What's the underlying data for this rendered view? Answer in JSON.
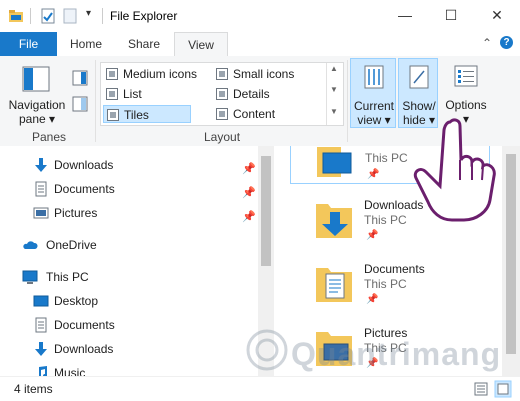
{
  "window": {
    "title": "File Explorer",
    "minimize": "—",
    "maximize": "☐",
    "close": "✕"
  },
  "tabs": [
    {
      "label": "File"
    },
    {
      "label": "Home"
    },
    {
      "label": "Share"
    },
    {
      "label": "View"
    }
  ],
  "ribbon": {
    "panes": {
      "navigation_pane_line1": "Navigation",
      "navigation_pane_line2": "pane ▾",
      "group_label": "Panes"
    },
    "layout": {
      "items": [
        {
          "label": "Medium icons"
        },
        {
          "label": "Small icons"
        },
        {
          "label": "List"
        },
        {
          "label": "Details"
        },
        {
          "label": "Tiles"
        },
        {
          "label": "Content"
        }
      ],
      "group_label": "Layout"
    },
    "current_view": {
      "line1": "Current",
      "line2": "view ▾"
    },
    "show_hide": {
      "line1": "Show/",
      "line2": "hide ▾"
    },
    "options": {
      "line1": "Options",
      "line2": "▾"
    },
    "help_icon": "?",
    "collapse_icon": "⌃"
  },
  "nav_pane": {
    "items": [
      {
        "label": "Downloads",
        "icon": "download-arrow-icon",
        "pinned": true
      },
      {
        "label": "Documents",
        "icon": "document-icon",
        "pinned": true
      },
      {
        "label": "Pictures",
        "icon": "picture-icon",
        "pinned": true
      },
      {
        "label": "OneDrive",
        "icon": "cloud-icon",
        "pinned": false
      },
      {
        "label": "This PC",
        "icon": "monitor-icon",
        "pinned": false
      },
      {
        "label": "Desktop",
        "icon": "desktop-icon",
        "pinned": false
      },
      {
        "label": "Documents",
        "icon": "document-icon",
        "pinned": false
      },
      {
        "label": "Downloads",
        "icon": "download-arrow-icon",
        "pinned": false
      },
      {
        "label": "Music",
        "icon": "music-icon",
        "pinned": false
      }
    ],
    "pin_glyph": "📌"
  },
  "content": {
    "tiles": [
      {
        "name": "",
        "sub": "This PC",
        "icon": "desktop-folder-icon"
      },
      {
        "name": "Downloads",
        "sub": "This PC",
        "icon": "downloads-folder-icon"
      },
      {
        "name": "Documents",
        "sub": "This PC",
        "icon": "documents-folder-icon"
      },
      {
        "name": "Pictures",
        "sub": "This PC",
        "icon": "pictures-folder-icon"
      }
    ]
  },
  "status": {
    "items_count": "4 items"
  },
  "watermark": {
    "text": "Quantrimang"
  },
  "colors": {
    "file_tab": "#1979ca",
    "selection": "#cce8ff",
    "selection_border": "#99d1ff",
    "folder": "#f3c75b",
    "accent_blue": "#1979ca"
  }
}
